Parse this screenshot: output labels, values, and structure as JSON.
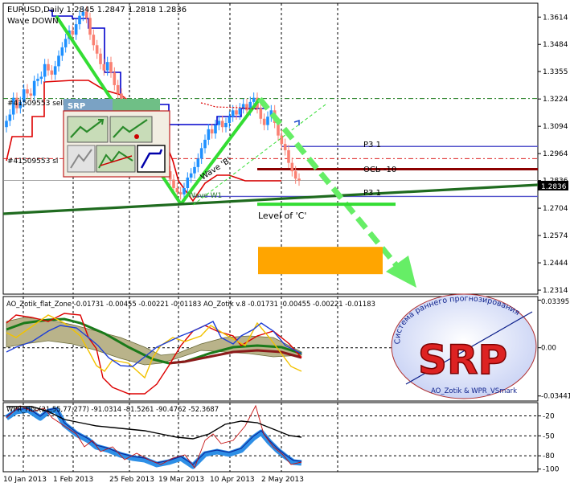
{
  "header": {
    "symbol_line": "EURUSD,Daily  1.2845 1.2847 1.2818 1.2836",
    "subtitle": "Wave DOWN"
  },
  "main_labels": {
    "sell_order": "#41509553 sell",
    "sl_order": "#41509553 sl",
    "wave_b": "Wave 'B'",
    "wave_w1": "Wave W1",
    "p3_upper": "P3 1",
    "axis_label": "ОСЬ -10",
    "p3_lower": "P3 1",
    "level_c": "Level of 'C'",
    "current_price": "1.2836"
  },
  "srp_panel": {
    "title": "SRP"
  },
  "indicator1": {
    "label": "AO_Zotik_flat_Zone -0.01731 -0.00455 -0.00221 -0.01183  AO_Zotik v.8 -0.01731 -0.00455 -0.00221 -0.01183"
  },
  "indicator2": {
    "label": "WPR_Fibo(21,55,77,277) -91.0314 -81.5261 -90.4762 -52.3687"
  },
  "logo": {
    "title": "SRP",
    "arc_text": "Система раннего прогнозирования",
    "footer": "AO_Zotik & WPR_VSmark"
  },
  "colors": {
    "bull": "#1e90ff",
    "bear": "#fa8072",
    "trend_green": "#33dd33",
    "dark_green": "#1f6b1f",
    "envelope": "#0000cc",
    "support_red": "#dd0000",
    "orange_zone": "#ffa500",
    "axis_dark_red": "#8b0000"
  },
  "chart_data": [
    {
      "type": "candlestick",
      "title": "EURUSD,Daily",
      "y_ticks": [
        "1.3614",
        "1.3484",
        "1.3355",
        "1.3224",
        "1.3094",
        "1.2964",
        "1.2836",
        "1.2704",
        "1.2574",
        "1.2444",
        "1.2314"
      ],
      "ylim": [
        1.2295,
        1.368
      ],
      "x_ticks": [
        "10 Jan 2013",
        "1 Feb 2013",
        "25 Feb 2013",
        "19 Mar 2013",
        "10 Apr 2013",
        "2 May 2013"
      ],
      "last_price": 1.2836,
      "candles": {
        "start": "2012-12-20",
        "closes": [
          1.312,
          1.315,
          1.323,
          1.318,
          1.321,
          1.327,
          1.325,
          1.324,
          1.331,
          1.332,
          1.333,
          1.339,
          1.336,
          1.334,
          1.338,
          1.343,
          1.347,
          1.351,
          1.355,
          1.353,
          1.358,
          1.362,
          1.364,
          1.361,
          1.353,
          1.348,
          1.344,
          1.339,
          1.336,
          1.34,
          1.335,
          1.329,
          1.325,
          1.321,
          1.317,
          1.319,
          1.314,
          1.309,
          1.306,
          1.303,
          1.3,
          1.305,
          1.301,
          1.296,
          1.294,
          1.29,
          1.288,
          1.284,
          1.28,
          1.278,
          1.277,
          1.28,
          1.285,
          1.287,
          1.29,
          1.294,
          1.299,
          1.303,
          1.308,
          1.306,
          1.31,
          1.312,
          1.309,
          1.311,
          1.314,
          1.317,
          1.315,
          1.318,
          1.32,
          1.317,
          1.321,
          1.323,
          1.318,
          1.313,
          1.31,
          1.314,
          1.317,
          1.311,
          1.305,
          1.301,
          1.298,
          1.292,
          1.288,
          1.2845,
          1.2836
        ]
      },
      "price_levels": [
        {
          "name": "P3 1",
          "value": 1.2998
        },
        {
          "name": "ОСЬ -10",
          "value": 1.289
        },
        {
          "name": "P3 1",
          "value": 1.276
        },
        {
          "name": "sell",
          "value": 1.3226
        },
        {
          "name": "sl",
          "value": 1.294
        }
      ],
      "orange_zone": [
        1.239,
        1.252
      ],
      "level_c": 1.2723
    },
    {
      "type": "line",
      "title": "AO_Zotik",
      "y_ticks": [
        "0.03395",
        "0.00",
        "-0.03441"
      ],
      "ylim": [
        -0.038,
        0.0365
      ]
    },
    {
      "type": "line",
      "title": "WPR_Fibo(21,55,77,277)",
      "y_ticks": [
        "-20",
        "-50",
        "-80",
        "-100"
      ],
      "ylim": [
        -104,
        0
      ]
    }
  ]
}
